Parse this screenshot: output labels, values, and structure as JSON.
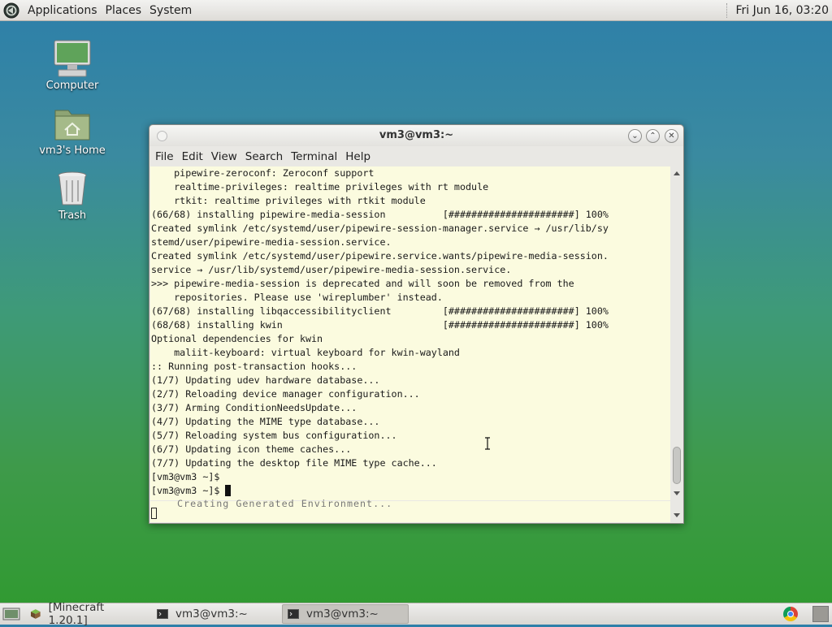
{
  "top_panel": {
    "menus": [
      "Applications",
      "Places",
      "System"
    ],
    "clock": "Fri Jun 16, 03:20"
  },
  "desktop_icons": [
    {
      "label": "Computer",
      "icon": "computer-icon"
    },
    {
      "label": "vm3's Home",
      "icon": "home-folder-icon"
    },
    {
      "label": "Trash",
      "icon": "trash-icon"
    }
  ],
  "window": {
    "title": "vm3@vm3:~",
    "menu": [
      "File",
      "Edit",
      "View",
      "Search",
      "Terminal",
      "Help"
    ],
    "lines": [
      "    pipewire-zeroconf: Zeroconf support",
      "    realtime-privileges: realtime privileges with rt module",
      "    rtkit: realtime privileges with rtkit module",
      "(66/68) installing pipewire-media-session          [######################] 100%",
      "Created symlink /etc/systemd/user/pipewire-session-manager.service → /usr/lib/sy",
      "stemd/user/pipewire-media-session.service.",
      "Created symlink /etc/systemd/user/pipewire.service.wants/pipewire-media-session.",
      "service → /usr/lib/systemd/user/pipewire-media-session.service.",
      ">>> pipewire-media-session is deprecated and will soon be removed from the",
      "    repositories. Please use 'wireplumber' instead.",
      "(67/68) installing libqaccessibilityclient         [######################] 100%",
      "(68/68) installing kwin                            [######################] 100%",
      "Optional dependencies for kwin",
      "    maliit-keyboard: virtual keyboard for kwin-wayland",
      ":: Running post-transaction hooks...",
      "(1/7) Updating udev hardware database...",
      "(2/7) Reloading device manager configuration...",
      "(3/7) Arming ConditionNeedsUpdate...",
      "(4/7) Updating the MIME type database...",
      "(5/7) Reloading system bus configuration...",
      "(6/7) Updating icon theme caches...",
      "(7/7) Updating the desktop file MIME type cache...",
      "[vm3@vm3 ~]$",
      "[vm3@vm3 ~]$ "
    ],
    "overlap_text": "Creating Generated Environment..."
  },
  "taskbar": {
    "tasks": [
      {
        "label": "[Minecraft 1.20.1]",
        "active": false
      },
      {
        "label": "vm3@vm3:~",
        "active": false
      },
      {
        "label": "vm3@vm3:~",
        "active": true
      }
    ]
  }
}
